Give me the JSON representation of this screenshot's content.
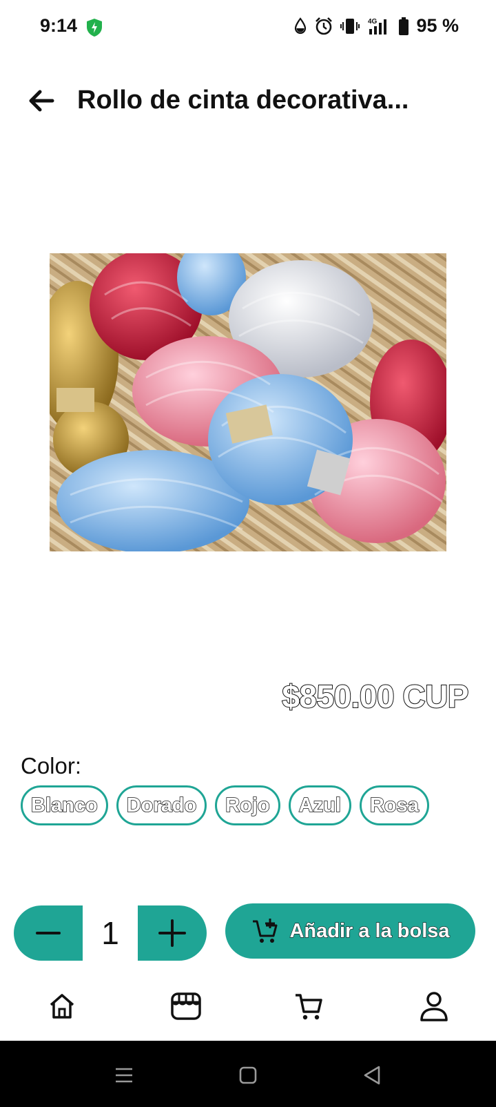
{
  "status_bar": {
    "time": "9:14",
    "battery_text": "95 %",
    "network_label": "4G",
    "icons": [
      "shield-icon",
      "water-drop-icon",
      "alarm-icon",
      "vibrate-icon",
      "signal-4g-icon",
      "battery-icon"
    ]
  },
  "header": {
    "title": "Rollo de cinta decorativa...",
    "back_icon": "arrow-left-icon"
  },
  "product": {
    "image_icon": "ribbon-rolls-photo",
    "price": "$850.00 CUP"
  },
  "colors": {
    "label": "Color:",
    "options": [
      "Blanco",
      "Dorado",
      "Rojo",
      "Azul",
      "Rosa"
    ]
  },
  "cart_controls": {
    "quantity": "1",
    "add_label": "Añadir a la bolsa",
    "minus_icon": "minus-icon",
    "plus_icon": "plus-icon",
    "cart_add_icon": "cart-add-icon"
  },
  "bottom_nav": {
    "items": [
      "home-icon",
      "store-icon",
      "cart-icon",
      "profile-icon"
    ]
  },
  "system_nav": {
    "buttons": [
      "menu-icon",
      "home-square-icon",
      "back-triangle-icon"
    ]
  },
  "theme": {
    "accent": "#1fa595",
    "background": "#ffffff",
    "system_nav_bg": "#000000"
  }
}
